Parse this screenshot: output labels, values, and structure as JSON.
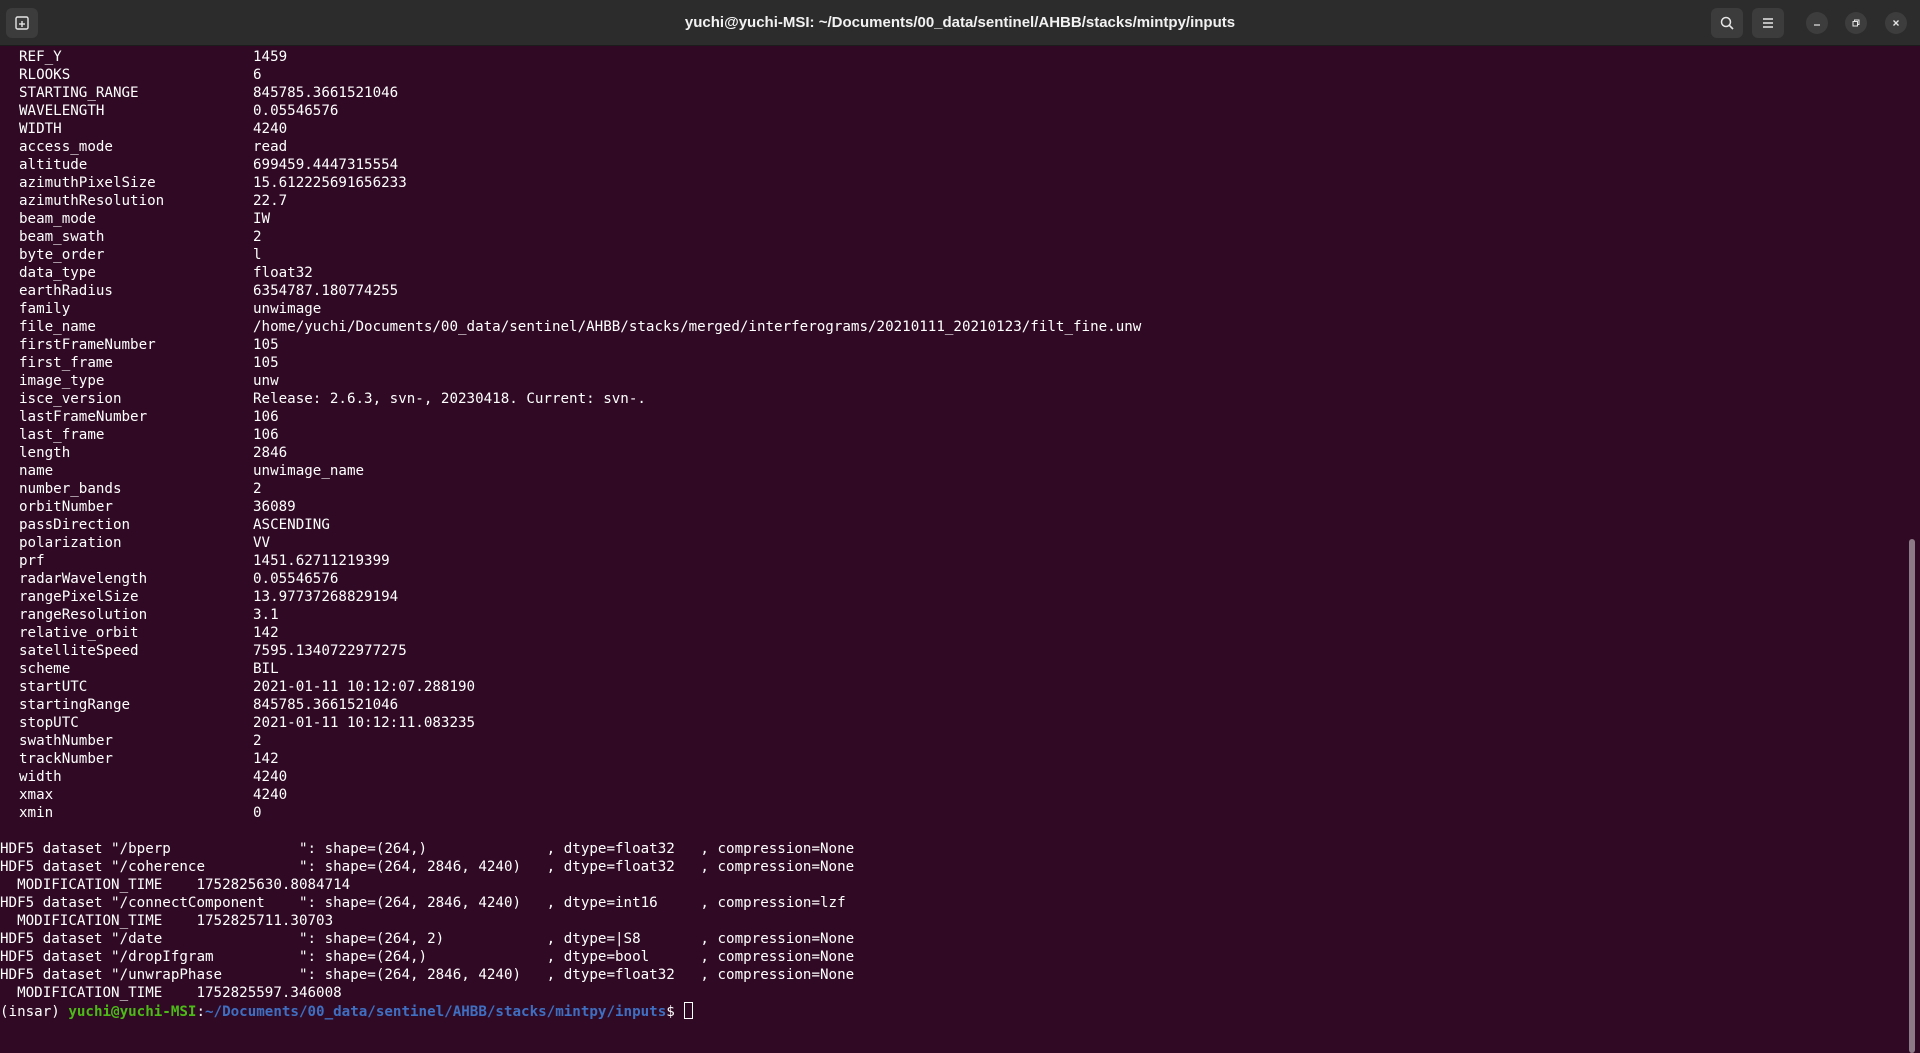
{
  "window": {
    "title": "yuchi@yuchi-MSI: ~/Documents/00_data/sentinel/AHBB/stacks/mintpy/inputs"
  },
  "icons": {
    "new_tab": "new-tab-icon",
    "search": "search-icon",
    "menu": "hamburger-menu-icon",
    "minimize": "minimize-icon",
    "maximize": "restore-icon",
    "close": "close-icon"
  },
  "colors": {
    "background": "#300a24",
    "titlebar": "#2c2c2c",
    "prompt_user": "#4cbb17",
    "prompt_path": "#3f6fc2",
    "text": "#ffffff"
  },
  "attributes": [
    {
      "key": "REF_Y",
      "value": "1459"
    },
    {
      "key": "RLOOKS",
      "value": "6"
    },
    {
      "key": "STARTING_RANGE",
      "value": "845785.3661521046"
    },
    {
      "key": "WAVELENGTH",
      "value": "0.05546576"
    },
    {
      "key": "WIDTH",
      "value": "4240"
    },
    {
      "key": "access_mode",
      "value": "read"
    },
    {
      "key": "altitude",
      "value": "699459.4447315554"
    },
    {
      "key": "azimuthPixelSize",
      "value": "15.612225691656233"
    },
    {
      "key": "azimuthResolution",
      "value": "22.7"
    },
    {
      "key": "beam_mode",
      "value": "IW"
    },
    {
      "key": "beam_swath",
      "value": "2"
    },
    {
      "key": "byte_order",
      "value": "l"
    },
    {
      "key": "data_type",
      "value": "float32"
    },
    {
      "key": "earthRadius",
      "value": "6354787.180774255"
    },
    {
      "key": "family",
      "value": "unwimage"
    },
    {
      "key": "file_name",
      "value": "/home/yuchi/Documents/00_data/sentinel/AHBB/stacks/merged/interferograms/20210111_20210123/filt_fine.unw"
    },
    {
      "key": "firstFrameNumber",
      "value": "105"
    },
    {
      "key": "first_frame",
      "value": "105"
    },
    {
      "key": "image_type",
      "value": "unw"
    },
    {
      "key": "isce_version",
      "value": "Release: 2.6.3, svn-, 20230418. Current: svn-."
    },
    {
      "key": "lastFrameNumber",
      "value": "106"
    },
    {
      "key": "last_frame",
      "value": "106"
    },
    {
      "key": "length",
      "value": "2846"
    },
    {
      "key": "name",
      "value": "unwimage_name"
    },
    {
      "key": "number_bands",
      "value": "2"
    },
    {
      "key": "orbitNumber",
      "value": "36089"
    },
    {
      "key": "passDirection",
      "value": "ASCENDING"
    },
    {
      "key": "polarization",
      "value": "VV"
    },
    {
      "key": "prf",
      "value": "1451.62711219399"
    },
    {
      "key": "radarWavelength",
      "value": "0.05546576"
    },
    {
      "key": "rangePixelSize",
      "value": "13.97737268829194"
    },
    {
      "key": "rangeResolution",
      "value": "3.1"
    },
    {
      "key": "relative_orbit",
      "value": "142"
    },
    {
      "key": "satelliteSpeed",
      "value": "7595.1340722977275"
    },
    {
      "key": "scheme",
      "value": "BIL"
    },
    {
      "key": "startUTC",
      "value": "2021-01-11 10:12:07.288190"
    },
    {
      "key": "startingRange",
      "value": "845785.3661521046"
    },
    {
      "key": "stopUTC",
      "value": "2021-01-11 10:12:11.083235"
    },
    {
      "key": "swathNumber",
      "value": "2"
    },
    {
      "key": "trackNumber",
      "value": "142"
    },
    {
      "key": "width",
      "value": "4240"
    },
    {
      "key": "xmax",
      "value": "4240"
    },
    {
      "key": "xmin",
      "value": "0"
    }
  ],
  "datasets_output": [
    "HDF5 dataset \"/bperp               \": shape=(264,)              , dtype=float32   , compression=None",
    "HDF5 dataset \"/coherence           \": shape=(264, 2846, 4240)   , dtype=float32   , compression=None",
    "  MODIFICATION_TIME    1752825630.8084714",
    "HDF5 dataset \"/connectComponent    \": shape=(264, 2846, 4240)   , dtype=int16     , compression=lzf",
    "  MODIFICATION_TIME    1752825711.30703",
    "HDF5 dataset \"/date                \": shape=(264, 2)            , dtype=|S8       , compression=None",
    "HDF5 dataset \"/dropIfgram          \": shape=(264,)              , dtype=bool      , compression=None",
    "HDF5 dataset \"/unwrapPhase         \": shape=(264, 2846, 4240)   , dtype=float32   , compression=None",
    "  MODIFICATION_TIME    1752825597.346008"
  ],
  "prompt": {
    "env": "(insar) ",
    "user_host": "yuchi@yuchi-MSI",
    "separator": ":",
    "path": "~/Documents/00_data/sentinel/AHBB/stacks/mintpy/inputs",
    "symbol": "$ "
  },
  "scrollbar": {
    "position_fraction": 0.49,
    "visible_fraction": 0.51
  }
}
